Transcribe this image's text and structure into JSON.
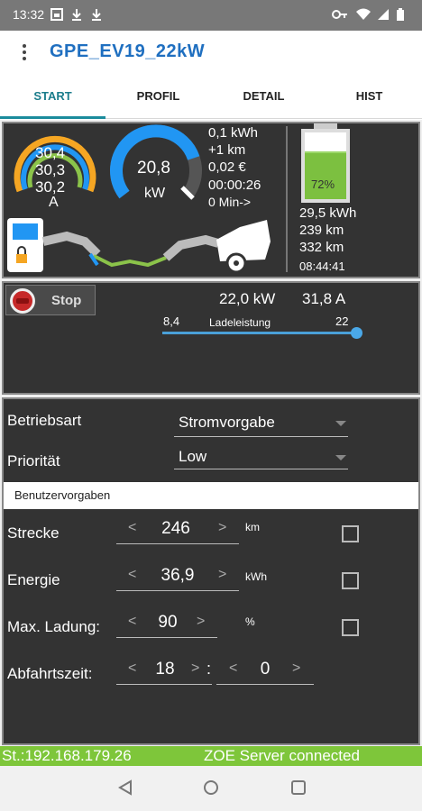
{
  "status_bar": {
    "time": "13:32",
    "left_icons": [
      "image-icon",
      "download-icon",
      "download-icon"
    ],
    "right_icons": [
      "key-icon",
      "wifi-icon",
      "signal-icon",
      "battery-icon"
    ]
  },
  "app_bar": {
    "title": "GPE_EV19_22kW"
  },
  "tabs": [
    {
      "label": "START",
      "active": true
    },
    {
      "label": "PROFIL",
      "active": false
    },
    {
      "label": "DETAIL",
      "active": false
    },
    {
      "label": "HIST",
      "active": false
    }
  ],
  "dashboard": {
    "current_gauge": {
      "phase1": "30,4",
      "phase2": "30,3",
      "phase3": "30,2",
      "unit": "A"
    },
    "power_gauge": {
      "value": "20,8",
      "unit": "kW",
      "fill_fraction": 0.78
    },
    "session": {
      "energy": "0,1 kWh",
      "distance": "+1 km",
      "cost": "0,02 €",
      "duration": "00:00:26",
      "remaining": "0 Min->"
    },
    "battery": {
      "soc": "72%",
      "soc_fraction": 0.72,
      "energy": "29,5 kWh",
      "range1": "239 km",
      "range2": "332 km",
      "time": "08:44:41"
    }
  },
  "charging": {
    "stop_label": "Stop",
    "power": "22,0 kW",
    "current": "31,8 A",
    "slider_min": "8,4",
    "slider_max": "22",
    "slider_label": "Ladeleistung",
    "slider_fraction": 1.0
  },
  "settings": {
    "mode_label": "Betriebsart",
    "mode_value": "Stromvorgabe",
    "priority_label": "Priorität",
    "priority_value": "Low",
    "section_header": "Benutzervorgaben",
    "distance": {
      "label": "Strecke",
      "value": "246",
      "unit": "km",
      "checked": false
    },
    "energy": {
      "label": "Energie",
      "value": "36,9",
      "unit": "kWh",
      "checked": false
    },
    "max_charge": {
      "label": "Max. Ladung:",
      "value": "90",
      "unit": "%",
      "checked": false
    },
    "departure": {
      "label": "Abfahrtszeit:",
      "hour": "18",
      "separator": ":",
      "minute": "0"
    }
  },
  "footer": {
    "station": "St.:192.168.179.26",
    "server_status": "ZOE Server connected"
  },
  "nav": [
    "back-icon",
    "home-icon",
    "recents-icon"
  ],
  "colors": {
    "accent": "#1f6fc0",
    "tab_indicator": "#1b8c9c",
    "status_green": "#7ec63a",
    "panel_bg": "#333333",
    "gauge_blue": "#2196f3",
    "gauge_orange": "#f5a623",
    "battery_green": "#7cc040",
    "stop_red": "#c62828"
  }
}
